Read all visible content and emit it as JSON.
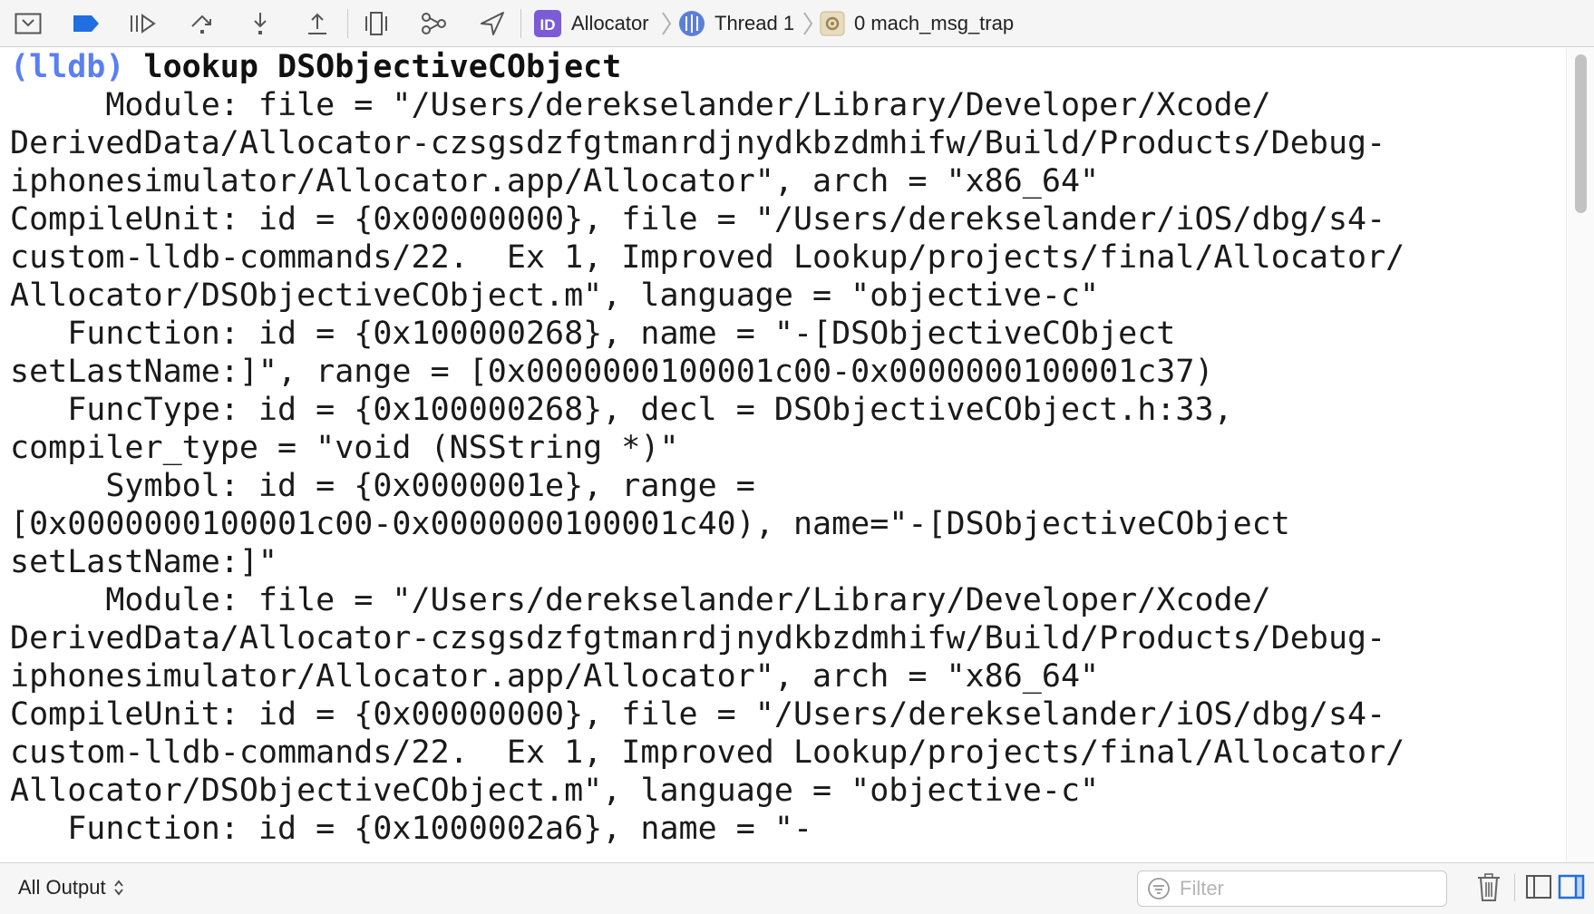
{
  "toolbar": {
    "breadcrumbs": [
      {
        "label": "Allocator",
        "icon": "project-icon"
      },
      {
        "label": "Thread 1",
        "icon": "thread-icon"
      },
      {
        "label": "0 mach_msg_trap",
        "icon": "frame-gear-icon"
      }
    ],
    "icons": [
      "hide-debug-area-icon",
      "breakpoints-toggle-icon",
      "continue-icon",
      "step-over-icon",
      "step-into-icon",
      "step-out-icon",
      "view-hierarchy-icon",
      "memory-graph-icon",
      "simulate-location-icon"
    ]
  },
  "console": {
    "prompt": "(lldb)",
    "command": "lookup DSObjectiveCObject",
    "lines": [
      "     Module: file = \"/Users/derekselander/Library/Developer/Xcode/",
      "DerivedData/Allocator-czsgsdzfgtmanrdjnydkbzdmhifw/Build/Products/Debug-",
      "iphonesimulator/Allocator.app/Allocator\", arch = \"x86_64\"",
      "CompileUnit: id = {0x00000000}, file = \"/Users/derekselander/iOS/dbg/s4-",
      "custom-lldb-commands/22.  Ex 1, Improved Lookup/projects/final/Allocator/",
      "Allocator/DSObjectiveCObject.m\", language = \"objective-c\"",
      "   Function: id = {0x100000268}, name = \"-[DSObjectiveCObject",
      "setLastName:]\", range = [0x0000000100001c00-0x0000000100001c37)",
      "   FuncType: id = {0x100000268}, decl = DSObjectiveCObject.h:33,",
      "compiler_type = \"void (NSString *)\"",
      "     Symbol: id = {0x0000001e}, range =",
      "[0x0000000100001c00-0x0000000100001c40), name=\"-[DSObjectiveCObject",
      "setLastName:]\"",
      "     Module: file = \"/Users/derekselander/Library/Developer/Xcode/",
      "DerivedData/Allocator-czsgsdzfgtmanrdjnydkbzdmhifw/Build/Products/Debug-",
      "iphonesimulator/Allocator.app/Allocator\", arch = \"x86_64\"",
      "CompileUnit: id = {0x00000000}, file = \"/Users/derekselander/iOS/dbg/s4-",
      "custom-lldb-commands/22.  Ex 1, Improved Lookup/projects/final/Allocator/",
      "Allocator/DSObjectiveCObject.m\", language = \"objective-c\"",
      "   Function: id = {0x1000002a6}, name = \"-"
    ]
  },
  "bottom": {
    "output_filter_selected": "All Output",
    "filter_placeholder": "Filter",
    "icons": [
      "trash-icon",
      "show-variables-view-icon",
      "show-console-view-icon"
    ]
  },
  "colors": {
    "prompt": "#5a7ff2",
    "accent": "#1f6fe0"
  }
}
